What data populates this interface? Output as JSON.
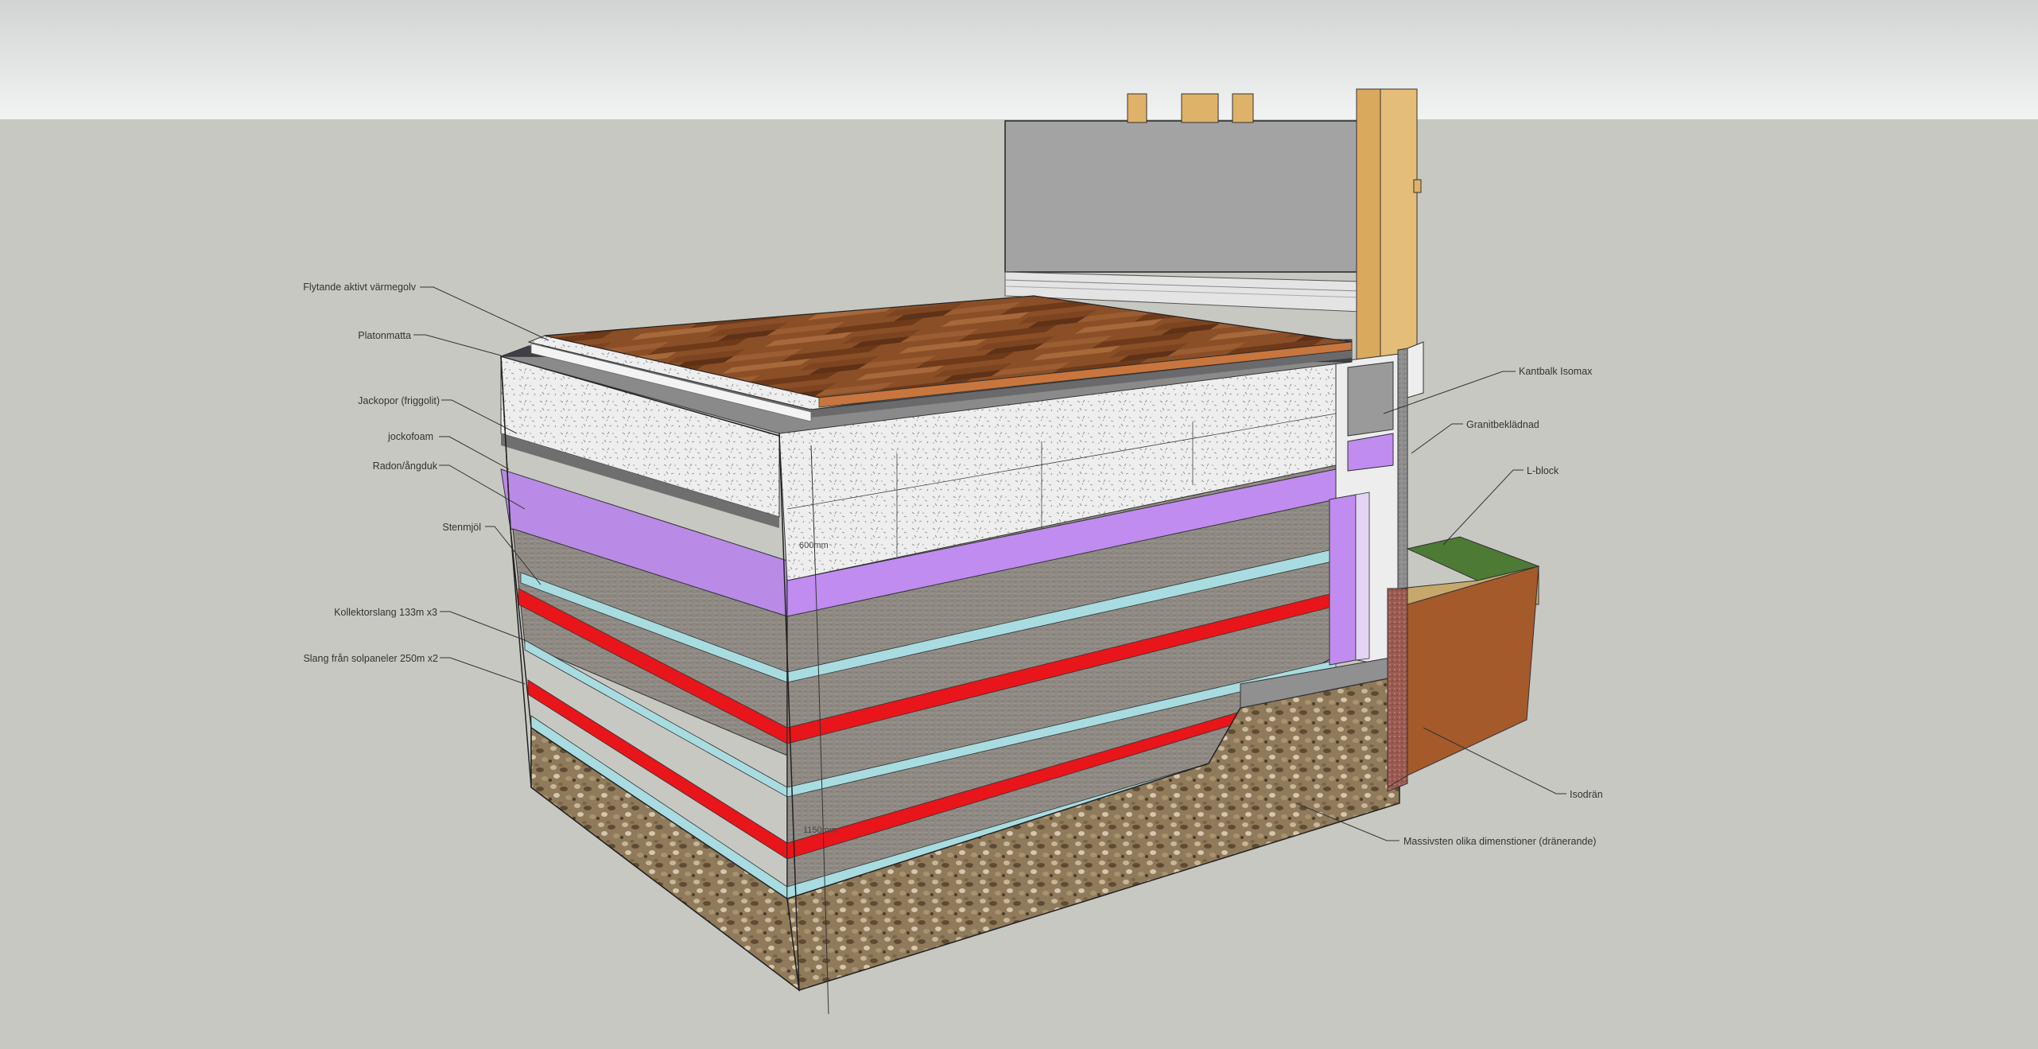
{
  "labels_left": [
    "Flytande aktivt värmegolv",
    "Platonmatta",
    "Jackopor (friggolit)",
    "jockofoam",
    "Radon/ångduk",
    "Stenmjöl",
    "Kollektorslang 133m x3",
    "Slang från solpaneler 250m x2"
  ],
  "labels_right": [
    "Kantbalk Isomax",
    "Granitbeklädnad",
    "L-block",
    "Isodrän",
    "Massivsten olika dimenstioner (dränerande)"
  ],
  "dimensions": {
    "insulation": "600mm",
    "total": "1150mm"
  },
  "colors": {
    "sky": "#e9eaea",
    "ground": "#c8c8c3",
    "floor_wood": "#8a4f27",
    "insulation_eps": "#efefef",
    "radon_membrane": "#bb8be8",
    "stone_dust": "#8d8881",
    "collector_hose": "#e8151a",
    "solar_hose": "#a8dce0",
    "gravel": "#8a7556",
    "wall": "#a9a9a9",
    "timber": "#dfb26a",
    "soil": "#a55a2c",
    "grass": "#4d7a34"
  }
}
